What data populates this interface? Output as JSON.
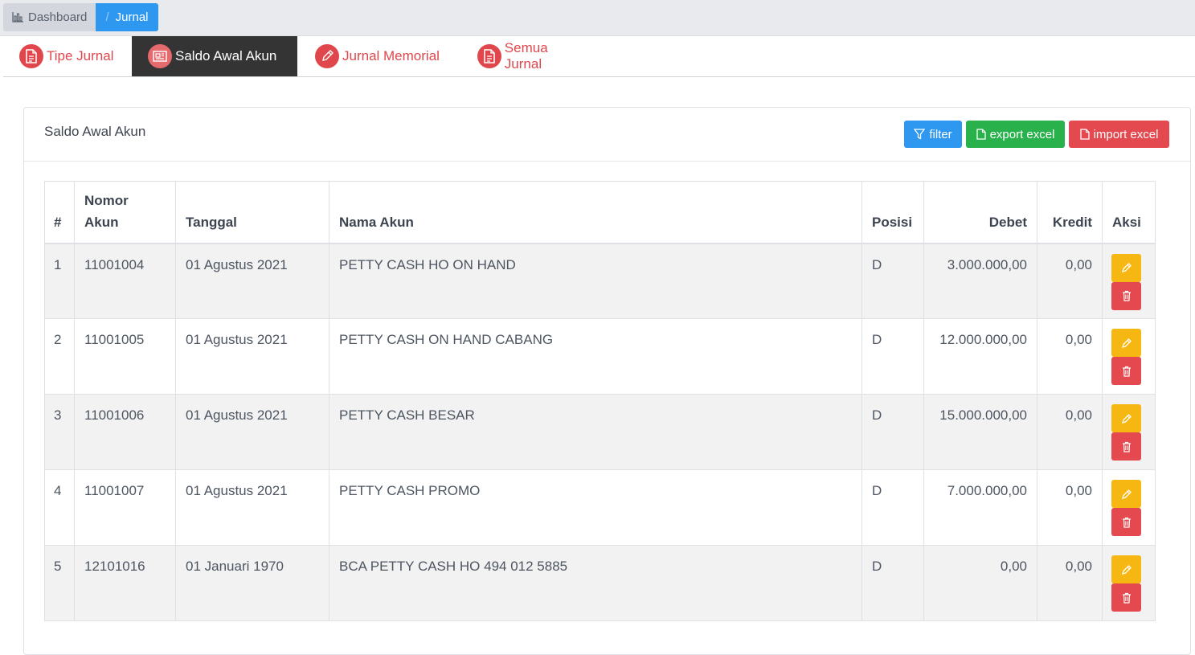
{
  "breadcrumb": {
    "home_label": "Dashboard",
    "separator": "/",
    "current_label": "Jurnal"
  },
  "tabs": [
    {
      "label": "Tipe Jurnal",
      "icon": "document-icon",
      "active": false
    },
    {
      "label": "Saldo Awal Akun",
      "icon": "newspaper-icon",
      "active": true
    },
    {
      "label": "Jurnal Memorial",
      "icon": "pencil-icon",
      "active": false
    },
    {
      "label": "Semua Jurnal",
      "icon": "document-icon",
      "active": false
    }
  ],
  "card": {
    "title": "Saldo Awal Akun",
    "buttons": {
      "filter": "filter",
      "export": "export excel",
      "import": "import excel"
    }
  },
  "table": {
    "headers": {
      "no": "#",
      "nomor_akun": "Nomor Akun",
      "tanggal": "Tanggal",
      "nama_akun": "Nama Akun",
      "posisi": "Posisi",
      "debet": "Debet",
      "kredit": "Kredit",
      "aksi": "Aksi"
    },
    "rows": [
      {
        "no": "1",
        "nomor": "11001004",
        "tanggal": "01 Agustus 2021",
        "nama": "PETTY CASH HO ON HAND",
        "posisi": "D",
        "debet": "3.000.000,00",
        "kredit": "0,00"
      },
      {
        "no": "2",
        "nomor": "11001005",
        "tanggal": "01 Agustus 2021",
        "nama": "PETTY CASH ON HAND CABANG",
        "posisi": "D",
        "debet": "12.000.000,00",
        "kredit": "0,00"
      },
      {
        "no": "3",
        "nomor": "11001006",
        "tanggal": "01 Agustus 2021",
        "nama": "PETTY CASH BESAR",
        "posisi": "D",
        "debet": "15.000.000,00",
        "kredit": "0,00"
      },
      {
        "no": "4",
        "nomor": "11001007",
        "tanggal": "01 Agustus 2021",
        "nama": "PETTY CASH PROMO",
        "posisi": "D",
        "debet": "7.000.000,00",
        "kredit": "0,00"
      },
      {
        "no": "5",
        "nomor": "12101016",
        "tanggal": "01 Januari 1970",
        "nama": "BCA PETTY CASH HO 494 012 5885",
        "posisi": "D",
        "debet": "0,00",
        "kredit": "0,00"
      }
    ]
  },
  "colors": {
    "primary": "#2e97f0",
    "success": "#29b24c",
    "danger": "#e4494f",
    "warning": "#f7b712",
    "tab_active_bg": "#343434"
  }
}
